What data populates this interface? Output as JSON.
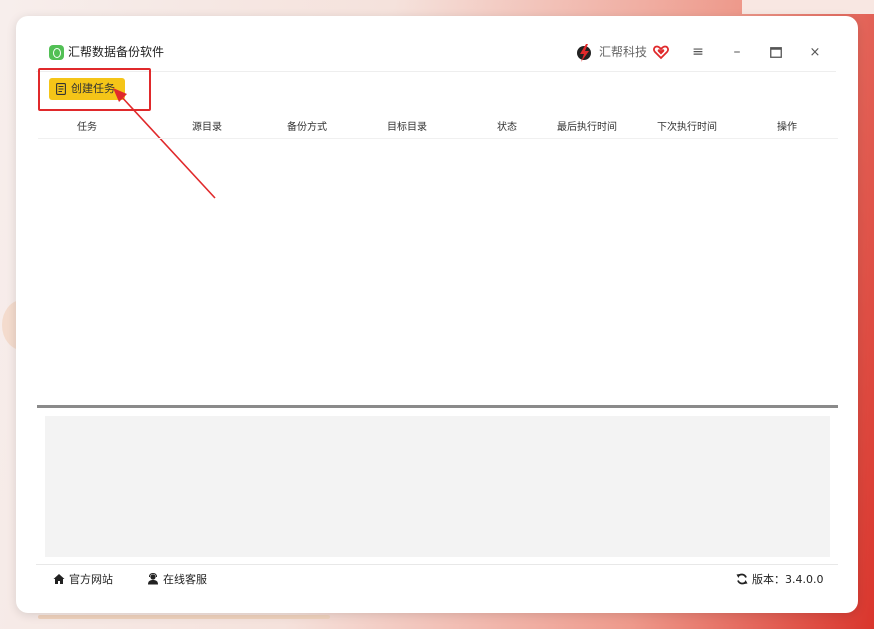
{
  "app": {
    "title": "汇帮数据备份软件"
  },
  "brand": {
    "name": "汇帮科技"
  },
  "window_controls": {
    "menu": "≡",
    "minimize": "–",
    "maximize": "🗖",
    "close": "×"
  },
  "toolbar": {
    "create_task_label": "创建任务"
  },
  "table": {
    "columns": [
      "任务",
      "源目录",
      "备份方式",
      "目标目录",
      "状态",
      "最后执行时间",
      "下次执行时间",
      "操作"
    ],
    "rows": []
  },
  "footer": {
    "website_label": "官方网站",
    "service_label": "在线客服",
    "version_label": "版本：3.4.0.0"
  },
  "colors": {
    "accent_button": "#f5c518",
    "highlight_red": "#e0292b",
    "app_icon_green": "#52c055"
  },
  "icons": {
    "app": "app-logo-icon",
    "brand": "brand-lightning-logo-icon",
    "heart": "heart-icon",
    "create": "document-icon",
    "website": "home-icon",
    "service": "customer-service-icon",
    "version": "refresh-icon"
  }
}
